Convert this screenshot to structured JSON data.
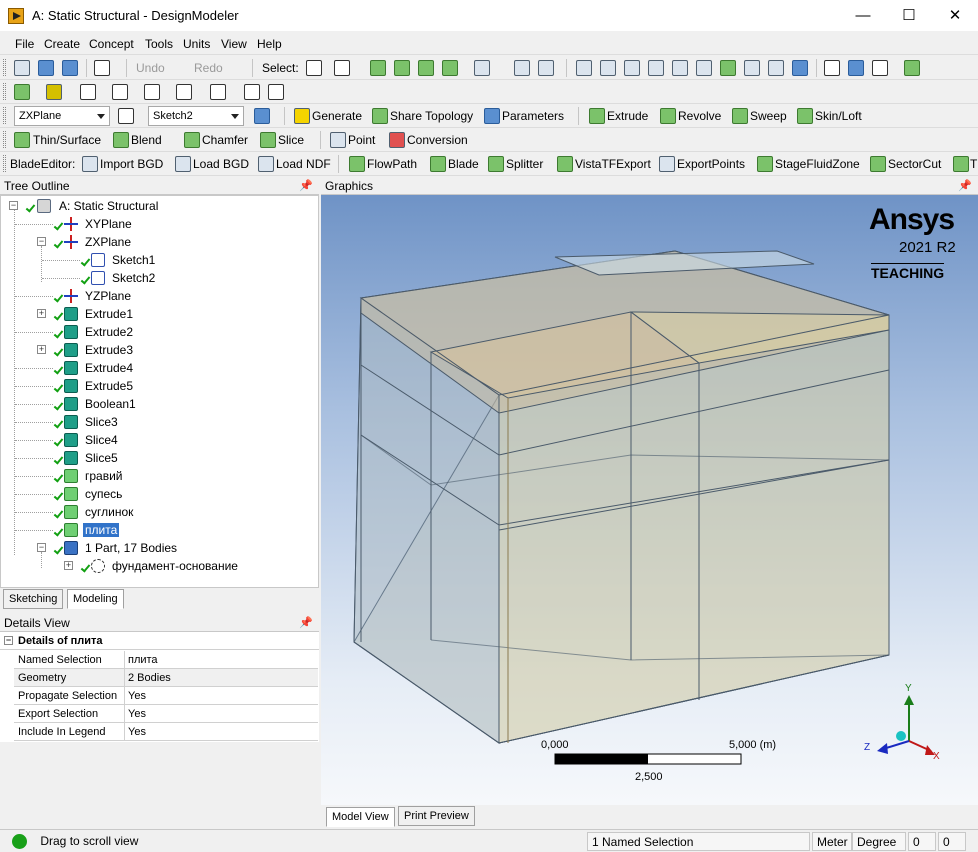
{
  "window": {
    "title": "A: Static Structural - DesignModeler",
    "minimize": "—",
    "maximize": "☐",
    "close": "✕"
  },
  "menu": [
    "File",
    "Create",
    "Concept",
    "Tools",
    "Units",
    "View",
    "Help"
  ],
  "toolbar1": {
    "undo": "Undo",
    "redo": "Redo",
    "select_label": "Select:"
  },
  "toolbar3": {
    "plane": "ZXPlane",
    "sketch": "Sketch2",
    "generate": "Generate",
    "share": "Share Topology",
    "parameters": "Parameters",
    "extrude": "Extrude",
    "revolve": "Revolve",
    "sweep": "Sweep",
    "skin": "Skin/Loft"
  },
  "toolbar4": {
    "thin": "Thin/Surface",
    "blend": "Blend",
    "chamfer": "Chamfer",
    "slice": "Slice",
    "point": "Point",
    "conversion": "Conversion"
  },
  "toolbar5": {
    "label": "BladeEditor:",
    "items": [
      "Import BGD",
      "Load BGD",
      "Load NDF",
      "FlowPath",
      "Blade",
      "Splitter",
      "VistaTFExport",
      "ExportPoints",
      "StageFluidZone",
      "SectorCut",
      "T"
    ]
  },
  "tree": {
    "title": "Tree Outline",
    "nodes": [
      {
        "label": "A: Static Structural"
      },
      {
        "label": "XYPlane"
      },
      {
        "label": "ZXPlane"
      },
      {
        "label": "Sketch1"
      },
      {
        "label": "Sketch2"
      },
      {
        "label": "YZPlane"
      },
      {
        "label": "Extrude1"
      },
      {
        "label": "Extrude2"
      },
      {
        "label": "Extrude3"
      },
      {
        "label": "Extrude4"
      },
      {
        "label": "Extrude5"
      },
      {
        "label": "Boolean1"
      },
      {
        "label": "Slice3"
      },
      {
        "label": "Slice4"
      },
      {
        "label": "Slice5"
      },
      {
        "label": "гравий"
      },
      {
        "label": "супесь"
      },
      {
        "label": "суглинок"
      },
      {
        "label": "плита"
      },
      {
        "label": "1 Part, 17 Bodies"
      },
      {
        "label": "фундамент-основание"
      }
    ]
  },
  "tabs_left": {
    "sketching": "Sketching",
    "modeling": "Modeling"
  },
  "details": {
    "title": "Details View",
    "header": "Details of плита",
    "rows": [
      {
        "key": "Named Selection",
        "value": "плита"
      },
      {
        "key": "Geometry",
        "value": "2 Bodies"
      },
      {
        "key": "Propagate Selection",
        "value": "Yes"
      },
      {
        "key": "Export Selection",
        "value": "Yes"
      },
      {
        "key": "Include In Legend",
        "value": "Yes"
      }
    ]
  },
  "graphics": {
    "title": "Graphics",
    "logo": "Ansys",
    "version": "2021 R2",
    "edition": "TEACHING",
    "scale": {
      "start": "0,000",
      "end": "5,000 (m)",
      "mid": "2,500"
    },
    "axes": {
      "y": "Y",
      "z": "Z",
      "x": "X"
    }
  },
  "tabs_bottom": {
    "model": "Model View",
    "print": "Print Preview"
  },
  "status": {
    "message": "Drag to scroll view",
    "selection": "1 Named Selection",
    "unit": "Meter",
    "angle": "Degree",
    "v1": "0",
    "v2": "0"
  },
  "colors": {
    "selection": "#3173c9",
    "accent": "#e8a317"
  }
}
